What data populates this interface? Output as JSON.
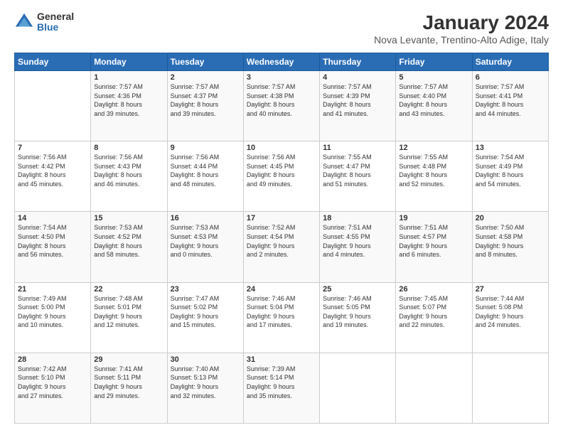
{
  "logo": {
    "general": "General",
    "blue": "Blue"
  },
  "title": "January 2024",
  "subtitle": "Nova Levante, Trentino-Alto Adige, Italy",
  "days_of_week": [
    "Sunday",
    "Monday",
    "Tuesday",
    "Wednesday",
    "Thursday",
    "Friday",
    "Saturday"
  ],
  "weeks": [
    [
      {
        "day": "",
        "info": ""
      },
      {
        "day": "1",
        "info": "Sunrise: 7:57 AM\nSunset: 4:36 PM\nDaylight: 8 hours\nand 39 minutes."
      },
      {
        "day": "2",
        "info": "Sunrise: 7:57 AM\nSunset: 4:37 PM\nDaylight: 8 hours\nand 39 minutes."
      },
      {
        "day": "3",
        "info": "Sunrise: 7:57 AM\nSunset: 4:38 PM\nDaylight: 8 hours\nand 40 minutes."
      },
      {
        "day": "4",
        "info": "Sunrise: 7:57 AM\nSunset: 4:39 PM\nDaylight: 8 hours\nand 41 minutes."
      },
      {
        "day": "5",
        "info": "Sunrise: 7:57 AM\nSunset: 4:40 PM\nDaylight: 8 hours\nand 43 minutes."
      },
      {
        "day": "6",
        "info": "Sunrise: 7:57 AM\nSunset: 4:41 PM\nDaylight: 8 hours\nand 44 minutes."
      }
    ],
    [
      {
        "day": "7",
        "info": "Sunrise: 7:56 AM\nSunset: 4:42 PM\nDaylight: 8 hours\nand 45 minutes."
      },
      {
        "day": "8",
        "info": "Sunrise: 7:56 AM\nSunset: 4:43 PM\nDaylight: 8 hours\nand 46 minutes."
      },
      {
        "day": "9",
        "info": "Sunrise: 7:56 AM\nSunset: 4:44 PM\nDaylight: 8 hours\nand 48 minutes."
      },
      {
        "day": "10",
        "info": "Sunrise: 7:56 AM\nSunset: 4:45 PM\nDaylight: 8 hours\nand 49 minutes."
      },
      {
        "day": "11",
        "info": "Sunrise: 7:55 AM\nSunset: 4:47 PM\nDaylight: 8 hours\nand 51 minutes."
      },
      {
        "day": "12",
        "info": "Sunrise: 7:55 AM\nSunset: 4:48 PM\nDaylight: 8 hours\nand 52 minutes."
      },
      {
        "day": "13",
        "info": "Sunrise: 7:54 AM\nSunset: 4:49 PM\nDaylight: 8 hours\nand 54 minutes."
      }
    ],
    [
      {
        "day": "14",
        "info": "Sunrise: 7:54 AM\nSunset: 4:50 PM\nDaylight: 8 hours\nand 56 minutes."
      },
      {
        "day": "15",
        "info": "Sunrise: 7:53 AM\nSunset: 4:52 PM\nDaylight: 8 hours\nand 58 minutes."
      },
      {
        "day": "16",
        "info": "Sunrise: 7:53 AM\nSunset: 4:53 PM\nDaylight: 9 hours\nand 0 minutes."
      },
      {
        "day": "17",
        "info": "Sunrise: 7:52 AM\nSunset: 4:54 PM\nDaylight: 9 hours\nand 2 minutes."
      },
      {
        "day": "18",
        "info": "Sunrise: 7:51 AM\nSunset: 4:55 PM\nDaylight: 9 hours\nand 4 minutes."
      },
      {
        "day": "19",
        "info": "Sunrise: 7:51 AM\nSunset: 4:57 PM\nDaylight: 9 hours\nand 6 minutes."
      },
      {
        "day": "20",
        "info": "Sunrise: 7:50 AM\nSunset: 4:58 PM\nDaylight: 9 hours\nand 8 minutes."
      }
    ],
    [
      {
        "day": "21",
        "info": "Sunrise: 7:49 AM\nSunset: 5:00 PM\nDaylight: 9 hours\nand 10 minutes."
      },
      {
        "day": "22",
        "info": "Sunrise: 7:48 AM\nSunset: 5:01 PM\nDaylight: 9 hours\nand 12 minutes."
      },
      {
        "day": "23",
        "info": "Sunrise: 7:47 AM\nSunset: 5:02 PM\nDaylight: 9 hours\nand 15 minutes."
      },
      {
        "day": "24",
        "info": "Sunrise: 7:46 AM\nSunset: 5:04 PM\nDaylight: 9 hours\nand 17 minutes."
      },
      {
        "day": "25",
        "info": "Sunrise: 7:46 AM\nSunset: 5:05 PM\nDaylight: 9 hours\nand 19 minutes."
      },
      {
        "day": "26",
        "info": "Sunrise: 7:45 AM\nSunset: 5:07 PM\nDaylight: 9 hours\nand 22 minutes."
      },
      {
        "day": "27",
        "info": "Sunrise: 7:44 AM\nSunset: 5:08 PM\nDaylight: 9 hours\nand 24 minutes."
      }
    ],
    [
      {
        "day": "28",
        "info": "Sunrise: 7:42 AM\nSunset: 5:10 PM\nDaylight: 9 hours\nand 27 minutes."
      },
      {
        "day": "29",
        "info": "Sunrise: 7:41 AM\nSunset: 5:11 PM\nDaylight: 9 hours\nand 29 minutes."
      },
      {
        "day": "30",
        "info": "Sunrise: 7:40 AM\nSunset: 5:13 PM\nDaylight: 9 hours\nand 32 minutes."
      },
      {
        "day": "31",
        "info": "Sunrise: 7:39 AM\nSunset: 5:14 PM\nDaylight: 9 hours\nand 35 minutes."
      },
      {
        "day": "",
        "info": ""
      },
      {
        "day": "",
        "info": ""
      },
      {
        "day": "",
        "info": ""
      }
    ]
  ]
}
